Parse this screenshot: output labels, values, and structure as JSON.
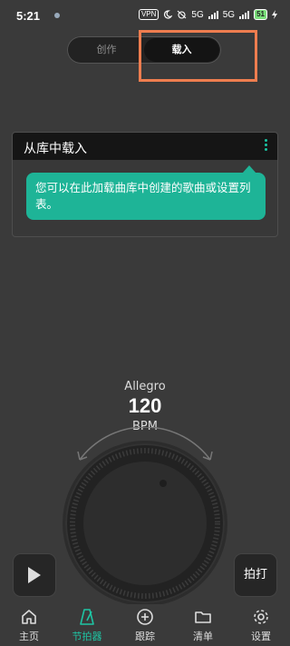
{
  "status_bar": {
    "time": "5:21",
    "vpn": "VPN",
    "net1": "5G",
    "net2": "5G",
    "battery": "51"
  },
  "segmented_control": {
    "options": [
      "创作",
      "载入"
    ],
    "selected": "载入"
  },
  "panel": {
    "title": "从库中载入",
    "tooltip": "您可以在此加载曲库中创建的歌曲或设置列表。"
  },
  "metronome": {
    "tempo_name": "Allegro",
    "bpm": "120",
    "bpm_unit": "BPM"
  },
  "controls": {
    "play_icon": "play-icon",
    "tap_label": "拍打"
  },
  "nav": {
    "items": [
      {
        "label": "主页",
        "icon": "home-icon"
      },
      {
        "label": "节拍器",
        "icon": "metronome-icon"
      },
      {
        "label": "跟踪",
        "icon": "plus-circle-icon"
      },
      {
        "label": "清单",
        "icon": "folder-icon"
      },
      {
        "label": "设置",
        "icon": "gear-icon"
      }
    ],
    "active": "节拍器"
  },
  "colors": {
    "accent": "#1eb497",
    "highlight": "#ee7d4f",
    "background": "#3a3a3a"
  }
}
